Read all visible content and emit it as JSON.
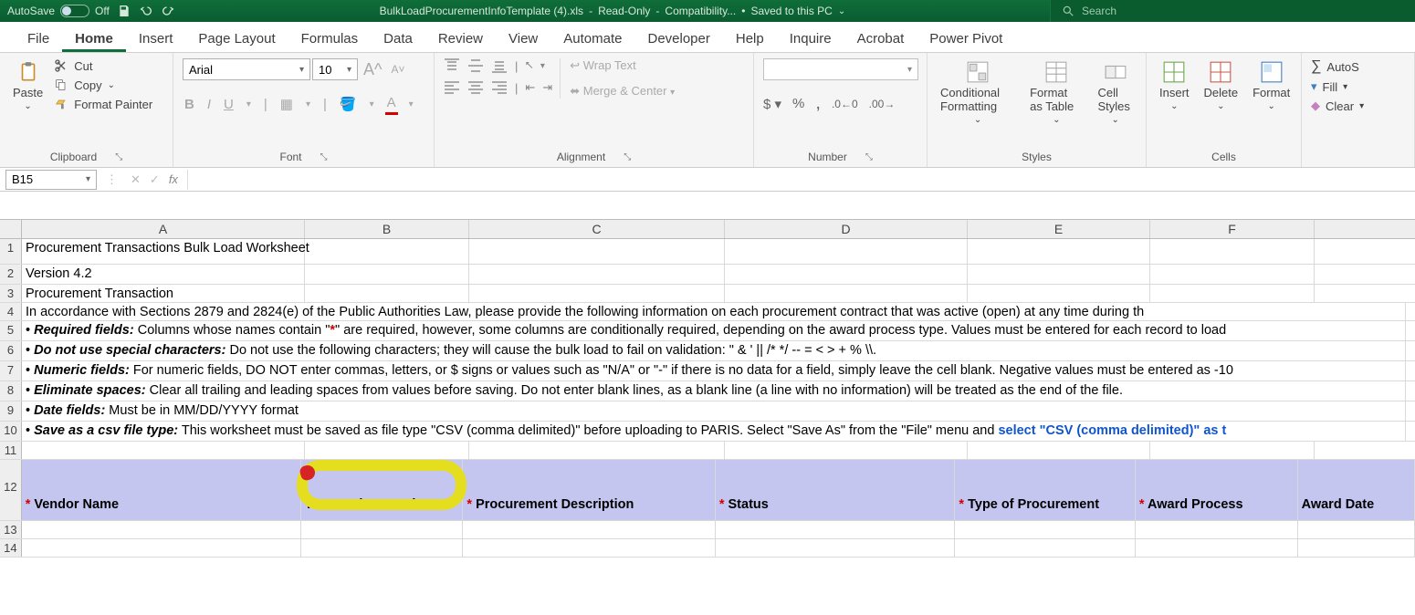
{
  "titlebar": {
    "autosave_label": "AutoSave",
    "autosave_state": "Off",
    "doc_name": "BulkLoadProcurementInfoTemplate (4).xls",
    "readonly": "Read-Only",
    "compat": "Compatibility...",
    "saved": "Saved to this PC",
    "search_placeholder": "Search"
  },
  "tabs": [
    "File",
    "Home",
    "Insert",
    "Page Layout",
    "Formulas",
    "Data",
    "Review",
    "View",
    "Automate",
    "Developer",
    "Help",
    "Inquire",
    "Acrobat",
    "Power Pivot"
  ],
  "active_tab": "Home",
  "ribbon": {
    "clipboard": {
      "paste": "Paste",
      "cut": "Cut",
      "copy": "Copy",
      "fp": "Format Painter",
      "label": "Clipboard"
    },
    "font": {
      "name": "Arial",
      "size": "10",
      "label": "Font"
    },
    "alignment": {
      "wrap": "Wrap Text",
      "merge": "Merge & Center",
      "label": "Alignment"
    },
    "number": {
      "label": "Number"
    },
    "styles": {
      "cf": "Conditional Formatting",
      "fat": "Format as Table",
      "cs": "Cell Styles",
      "label": "Styles"
    },
    "cells": {
      "insert": "Insert",
      "delete": "Delete",
      "format": "Format",
      "label": "Cells"
    },
    "editing": {
      "autosum": "AutoS",
      "fill": "Fill",
      "clear": "Clear"
    }
  },
  "namebox": "B15",
  "columns": [
    "A",
    "B",
    "C",
    "D",
    "E",
    "F"
  ],
  "rows": {
    "r1": "Procurement Transactions Bulk Load Worksheet",
    "r2": "Version 4.2",
    "r3": "Procurement Transaction",
    "r4": "In accordance with Sections 2879 and 2824(e) of the Public Authorities Law, please provide the following information on each procurement contract that was active (open) at any time during th",
    "r5_lead": "Required fields:",
    "r5_tail_a": "  Columns whose names contain \"",
    "r5_tail_b": "\" are required, however, some columns are conditionally required, depending on the award process type. Values must be entered for each record to load",
    "r6_lead": "Do not use special characters:",
    "r6_tail": "  Do not use the following characters; they will cause the bulk load to fail on validation:  \" & ' || /* */ -- = < > + % \\\\.",
    "r7_lead": "Numeric fields:",
    "r7_tail": "  For numeric fields, DO NOT enter commas, letters, or $ signs or values such as \"N/A\" or \"-\" if there is no data for a field, simply leave the cell blank. Negative values must be entered as -10",
    "r8_lead": "Eliminate spaces:",
    "r8_tail": "  Clear all trailing and leading spaces from values before saving. Do not enter blank lines, as a blank line (a line with no information) will be treated as the end of the file.",
    "r9_lead": "Date fields:",
    "r9_tail": "  Must be in MM/DD/YYYY format",
    "r10_lead": "Save as a csv file type:",
    "r10_tail": "  This worksheet must be saved as file type \"CSV (comma delimited)\" before uploading to PARIS.  Select \"Save As\" from the \"File\" menu and ",
    "r10_link": "select \"CSV (comma delimited)\" as t"
  },
  "headers": {
    "A": "Vendor Name",
    "B": "Transaction Number",
    "C": "Procurement Description",
    "D": "Status",
    "E": "Type of Procurement",
    "F": "Award Process",
    "G": "Award Date"
  }
}
